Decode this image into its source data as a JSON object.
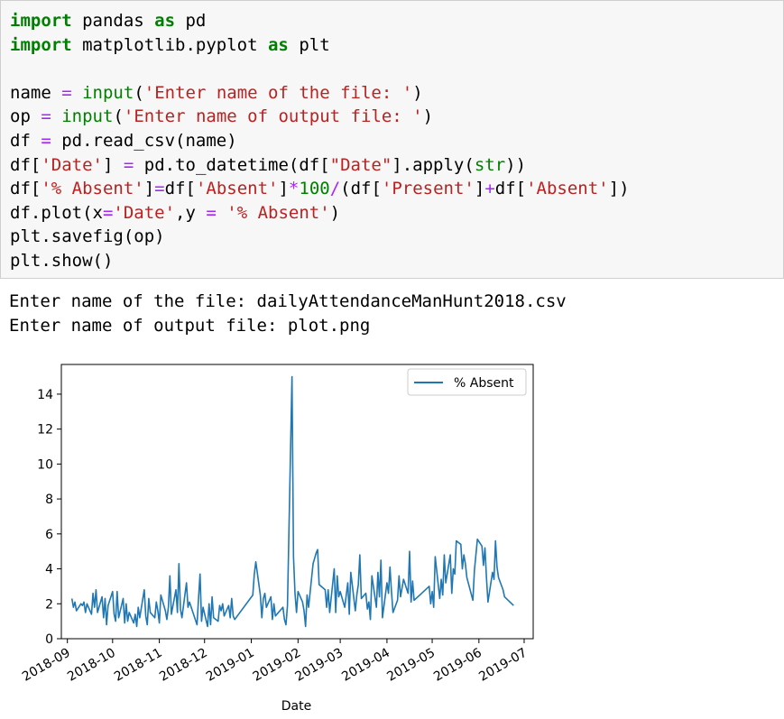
{
  "code_lines": [
    [
      {
        "t": "import",
        "c": "kw"
      },
      {
        "t": " pandas "
      },
      {
        "t": "as",
        "c": "kw"
      },
      {
        "t": " pd"
      }
    ],
    [
      {
        "t": "import",
        "c": "kw"
      },
      {
        "t": " matplotlib.pyplot "
      },
      {
        "t": "as",
        "c": "kw"
      },
      {
        "t": " plt"
      }
    ],
    [],
    [
      {
        "t": "name "
      },
      {
        "t": "=",
        "c": "op"
      },
      {
        "t": " "
      },
      {
        "t": "input",
        "c": "bi"
      },
      {
        "t": "("
      },
      {
        "t": "'Enter name of the file: '",
        "c": "str"
      },
      {
        "t": ")"
      }
    ],
    [
      {
        "t": "op "
      },
      {
        "t": "=",
        "c": "op"
      },
      {
        "t": " "
      },
      {
        "t": "input",
        "c": "bi"
      },
      {
        "t": "("
      },
      {
        "t": "'Enter name of output file: '",
        "c": "str"
      },
      {
        "t": ")"
      }
    ],
    [
      {
        "t": "df "
      },
      {
        "t": "=",
        "c": "op"
      },
      {
        "t": " pd.read_csv(name)"
      }
    ],
    [
      {
        "t": "df["
      },
      {
        "t": "'Date'",
        "c": "str"
      },
      {
        "t": "] "
      },
      {
        "t": "=",
        "c": "op"
      },
      {
        "t": " pd.to_datetime(df["
      },
      {
        "t": "\"Date\"",
        "c": "str"
      },
      {
        "t": "].apply("
      },
      {
        "t": "str",
        "c": "bi"
      },
      {
        "t": "))"
      }
    ],
    [
      {
        "t": "df["
      },
      {
        "t": "'% Absent'",
        "c": "str"
      },
      {
        "t": "]"
      },
      {
        "t": "=",
        "c": "op"
      },
      {
        "t": "df["
      },
      {
        "t": "'Absent'",
        "c": "str"
      },
      {
        "t": "]"
      },
      {
        "t": "*",
        "c": "op"
      },
      {
        "t": "100",
        "c": "num"
      },
      {
        "t": "/",
        "c": "op"
      },
      {
        "t": "(df["
      },
      {
        "t": "'Present'",
        "c": "str"
      },
      {
        "t": "]"
      },
      {
        "t": "+",
        "c": "op"
      },
      {
        "t": "df["
      },
      {
        "t": "'Absent'",
        "c": "str"
      },
      {
        "t": "])"
      }
    ],
    [
      {
        "t": "df.plot(x"
      },
      {
        "t": "=",
        "c": "op"
      },
      {
        "t": "'Date'",
        "c": "str"
      },
      {
        "t": ",y "
      },
      {
        "t": "=",
        "c": "op"
      },
      {
        "t": " "
      },
      {
        "t": "'% Absent'",
        "c": "str"
      },
      {
        "t": ")"
      }
    ],
    [
      {
        "t": "plt.savefig(op)"
      }
    ],
    [
      {
        "t": "plt.show()"
      }
    ]
  ],
  "output_lines": [
    "Enter name of the file: dailyAttendanceManHunt2018.csv",
    "Enter name of output file: plot.png"
  ],
  "chart_data": {
    "type": "line",
    "xlabel": "Date",
    "ylabel": "",
    "legend": [
      "% Absent"
    ],
    "legend_placement": "upper-right",
    "grid": false,
    "line_color": "#1f77b4",
    "xlim": [
      "2018-08-28",
      "2019-07-07"
    ],
    "ylim": [
      0,
      15.7
    ],
    "xticks": [
      "2018-09",
      "2018-10",
      "2018-11",
      "2018-12",
      "2019-01",
      "2019-02",
      "2019-03",
      "2019-04",
      "2019-05",
      "2019-06",
      "2019-07"
    ],
    "yticks": [
      0,
      2,
      4,
      6,
      8,
      10,
      12,
      14
    ],
    "series": [
      {
        "name": "% Absent",
        "points": [
          [
            "2018-09-04",
            2.3
          ],
          [
            "2018-09-05",
            1.8
          ],
          [
            "2018-09-06",
            2.1
          ],
          [
            "2018-09-07",
            1.6
          ],
          [
            "2018-09-10",
            2.0
          ],
          [
            "2018-09-11",
            1.9
          ],
          [
            "2018-09-12",
            2.1
          ],
          [
            "2018-09-13",
            1.5
          ],
          [
            "2018-09-14",
            2.0
          ],
          [
            "2018-09-17",
            1.4
          ],
          [
            "2018-09-18",
            2.6
          ],
          [
            "2018-09-19",
            1.8
          ],
          [
            "2018-09-20",
            2.8
          ],
          [
            "2018-09-21",
            1.5
          ],
          [
            "2018-09-24",
            2.4
          ],
          [
            "2018-09-25",
            1.2
          ],
          [
            "2018-09-26",
            2.3
          ],
          [
            "2018-09-27",
            0.8
          ],
          [
            "2018-09-28",
            1.9
          ],
          [
            "2018-10-01",
            2.7
          ],
          [
            "2018-10-02",
            1.4
          ],
          [
            "2018-10-03",
            1.0
          ],
          [
            "2018-10-04",
            2.7
          ],
          [
            "2018-10-05",
            1.2
          ],
          [
            "2018-10-08",
            2.3
          ],
          [
            "2018-10-09",
            0.9
          ],
          [
            "2018-10-10",
            2.0
          ],
          [
            "2018-10-11",
            1.0
          ],
          [
            "2018-10-12",
            1.5
          ],
          [
            "2018-10-15",
            0.9
          ],
          [
            "2018-10-16",
            1.4
          ],
          [
            "2018-10-17",
            0.7
          ],
          [
            "2018-10-18",
            1.8
          ],
          [
            "2018-10-19",
            1.2
          ],
          [
            "2018-10-22",
            2.8
          ],
          [
            "2018-10-23",
            1.3
          ],
          [
            "2018-10-24",
            0.8
          ],
          [
            "2018-10-25",
            2.3
          ],
          [
            "2018-10-26",
            1.5
          ],
          [
            "2018-10-29",
            1.2
          ],
          [
            "2018-10-30",
            2.1
          ],
          [
            "2018-10-31",
            1.6
          ],
          [
            "2018-11-01",
            0.9
          ],
          [
            "2018-11-02",
            2.5
          ],
          [
            "2018-11-05",
            1.6
          ],
          [
            "2018-11-06",
            1.1
          ],
          [
            "2018-11-07",
            1.8
          ],
          [
            "2018-11-08",
            3.6
          ],
          [
            "2018-11-09",
            1.4
          ],
          [
            "2018-11-12",
            2.8
          ],
          [
            "2018-11-13",
            1.5
          ],
          [
            "2018-11-14",
            4.3
          ],
          [
            "2018-11-15",
            1.7
          ],
          [
            "2018-11-16",
            1.2
          ],
          [
            "2018-11-19",
            3.2
          ],
          [
            "2018-11-20",
            1.8
          ],
          [
            "2018-11-21",
            2.1
          ],
          [
            "2018-11-26",
            0.8
          ],
          [
            "2018-11-27",
            2.3
          ],
          [
            "2018-11-28",
            3.7
          ],
          [
            "2018-11-29",
            1.0
          ],
          [
            "2018-11-30",
            1.8
          ],
          [
            "2018-12-03",
            0.7
          ],
          [
            "2018-12-04",
            2.0
          ],
          [
            "2018-12-05",
            0.8
          ],
          [
            "2018-12-06",
            2.4
          ],
          [
            "2018-12-07",
            1.2
          ],
          [
            "2018-12-10",
            1.0
          ],
          [
            "2018-12-11",
            1.9
          ],
          [
            "2018-12-12",
            1.6
          ],
          [
            "2018-12-13",
            2.0
          ],
          [
            "2018-12-14",
            1.3
          ],
          [
            "2018-12-17",
            1.9
          ],
          [
            "2018-12-18",
            1.2
          ],
          [
            "2018-12-19",
            2.3
          ],
          [
            "2018-12-20",
            1.3
          ],
          [
            "2018-12-21",
            1.1
          ],
          [
            "2019-01-02",
            2.5
          ],
          [
            "2019-01-03",
            3.7
          ],
          [
            "2019-01-04",
            4.4
          ],
          [
            "2019-01-07",
            2.5
          ],
          [
            "2019-01-08",
            1.2
          ],
          [
            "2019-01-09",
            2.3
          ],
          [
            "2019-01-10",
            2.6
          ],
          [
            "2019-01-11",
            1.8
          ],
          [
            "2019-01-14",
            2.4
          ],
          [
            "2019-01-15",
            1.1
          ],
          [
            "2019-01-16",
            2.0
          ],
          [
            "2019-01-17",
            1.3
          ],
          [
            "2019-01-22",
            1.8
          ],
          [
            "2019-01-23",
            1.1
          ],
          [
            "2019-01-24",
            0.8
          ],
          [
            "2019-01-25",
            1.9
          ],
          [
            "2019-01-28",
            15.0
          ],
          [
            "2019-01-29",
            4.7
          ],
          [
            "2019-01-30",
            2.6
          ],
          [
            "2019-01-31",
            1.5
          ],
          [
            "2019-02-01",
            2.7
          ],
          [
            "2019-02-04",
            2.1
          ],
          [
            "2019-02-05",
            1.6
          ],
          [
            "2019-02-06",
            0.7
          ],
          [
            "2019-02-07",
            2.5
          ],
          [
            "2019-02-08",
            1.8
          ],
          [
            "2019-02-11",
            4.3
          ],
          [
            "2019-02-12",
            4.6
          ],
          [
            "2019-02-13",
            4.9
          ],
          [
            "2019-02-14",
            5.1
          ],
          [
            "2019-02-15",
            3.1
          ],
          [
            "2019-02-19",
            2.8
          ],
          [
            "2019-02-20",
            1.8
          ],
          [
            "2019-02-21",
            2.8
          ],
          [
            "2019-02-22",
            1.5
          ],
          [
            "2019-02-25",
            4.0
          ],
          [
            "2019-02-26",
            1.5
          ],
          [
            "2019-02-27",
            3.6
          ],
          [
            "2019-02-28",
            2.4
          ],
          [
            "2019-03-01",
            2.7
          ],
          [
            "2019-03-04",
            1.8
          ],
          [
            "2019-03-05",
            2.5
          ],
          [
            "2019-03-06",
            3.2
          ],
          [
            "2019-03-07",
            1.4
          ],
          [
            "2019-03-08",
            3.8
          ],
          [
            "2019-03-11",
            1.6
          ],
          [
            "2019-03-12",
            2.5
          ],
          [
            "2019-03-13",
            3.1
          ],
          [
            "2019-03-14",
            4.8
          ],
          [
            "2019-03-15",
            2.3
          ],
          [
            "2019-03-18",
            2.6
          ],
          [
            "2019-03-19",
            1.7
          ],
          [
            "2019-03-20",
            2.1
          ],
          [
            "2019-03-21",
            1.1
          ],
          [
            "2019-03-22",
            3.6
          ],
          [
            "2019-03-25",
            1.8
          ],
          [
            "2019-03-26",
            3.8
          ],
          [
            "2019-03-27",
            2.4
          ],
          [
            "2019-03-28",
            4.5
          ],
          [
            "2019-03-29",
            1.2
          ],
          [
            "2019-04-01",
            3.2
          ],
          [
            "2019-04-02",
            2.6
          ],
          [
            "2019-04-03",
            4.1
          ],
          [
            "2019-04-04",
            2.7
          ],
          [
            "2019-04-05",
            1.5
          ],
          [
            "2019-04-08",
            2.2
          ],
          [
            "2019-04-09",
            3.6
          ],
          [
            "2019-04-10",
            2.4
          ],
          [
            "2019-04-11",
            2.9
          ],
          [
            "2019-04-12",
            3.4
          ],
          [
            "2019-04-15",
            2.6
          ],
          [
            "2019-04-16",
            5.0
          ],
          [
            "2019-04-17",
            2.1
          ],
          [
            "2019-04-18",
            3.3
          ],
          [
            "2019-04-19",
            2.2
          ],
          [
            "2019-04-29",
            3.0
          ],
          [
            "2019-04-30",
            2.0
          ],
          [
            "2019-05-01",
            2.7
          ],
          [
            "2019-05-02",
            1.8
          ],
          [
            "2019-05-03",
            4.7
          ],
          [
            "2019-05-06",
            2.3
          ],
          [
            "2019-05-07",
            3.4
          ],
          [
            "2019-05-08",
            2.5
          ],
          [
            "2019-05-09",
            4.8
          ],
          [
            "2019-05-10",
            3.2
          ],
          [
            "2019-05-13",
            4.8
          ],
          [
            "2019-05-14",
            2.6
          ],
          [
            "2019-05-15",
            4.0
          ],
          [
            "2019-05-16",
            3.7
          ],
          [
            "2019-05-17",
            5.6
          ],
          [
            "2019-05-20",
            5.4
          ],
          [
            "2019-05-21",
            4.0
          ],
          [
            "2019-05-22",
            4.8
          ],
          [
            "2019-05-23",
            4.3
          ],
          [
            "2019-05-24",
            3.5
          ],
          [
            "2019-05-28",
            2.2
          ],
          [
            "2019-05-29",
            3.9
          ],
          [
            "2019-05-30",
            4.8
          ],
          [
            "2019-05-31",
            5.7
          ],
          [
            "2019-06-03",
            5.3
          ],
          [
            "2019-06-04",
            4.2
          ],
          [
            "2019-06-05",
            5.2
          ],
          [
            "2019-06-06",
            3.5
          ],
          [
            "2019-06-07",
            2.1
          ],
          [
            "2019-06-10",
            3.8
          ],
          [
            "2019-06-11",
            3.4
          ],
          [
            "2019-06-12",
            5.6
          ],
          [
            "2019-06-13",
            4.1
          ],
          [
            "2019-06-14",
            3.5
          ],
          [
            "2019-06-17",
            2.8
          ],
          [
            "2019-06-18",
            2.4
          ],
          [
            "2019-06-24",
            1.9
          ]
        ]
      }
    ]
  }
}
